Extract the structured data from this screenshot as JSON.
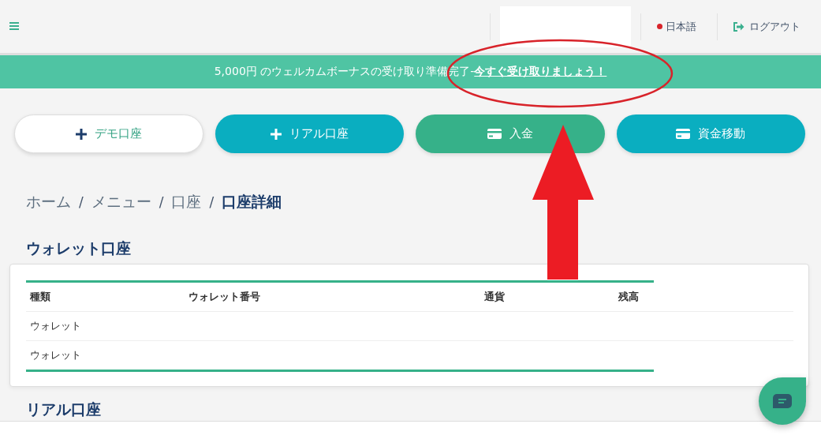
{
  "header": {
    "language": "日本語",
    "logout": "ログアウト"
  },
  "banner": {
    "text": "5,000円 のウェルカムボーナスの受け取り準備完了- ",
    "link": "今すぐ受け取りましょう！"
  },
  "actions": [
    {
      "label": "デモ口座",
      "kind": "outline"
    },
    {
      "label": "リアル口座",
      "kind": "teal"
    },
    {
      "label": "入金",
      "kind": "green"
    },
    {
      "label": "資金移動",
      "kind": "teal"
    }
  ],
  "breadcrumb": [
    {
      "label": "ホーム",
      "current": false
    },
    {
      "label": "メニュー",
      "current": false
    },
    {
      "label": "口座",
      "current": false
    },
    {
      "label": "口座詳細",
      "current": true
    }
  ],
  "breadcrumb_separator": "/",
  "wallet_section": {
    "title": "ウォレット口座",
    "table": {
      "columns": [
        "種類",
        "ウォレット番号",
        "通貨",
        "残高"
      ],
      "rows": [
        [
          "ウォレット"
        ],
        [
          "ウォレット"
        ]
      ]
    }
  },
  "real_section": {
    "title": "リアル口座"
  }
}
